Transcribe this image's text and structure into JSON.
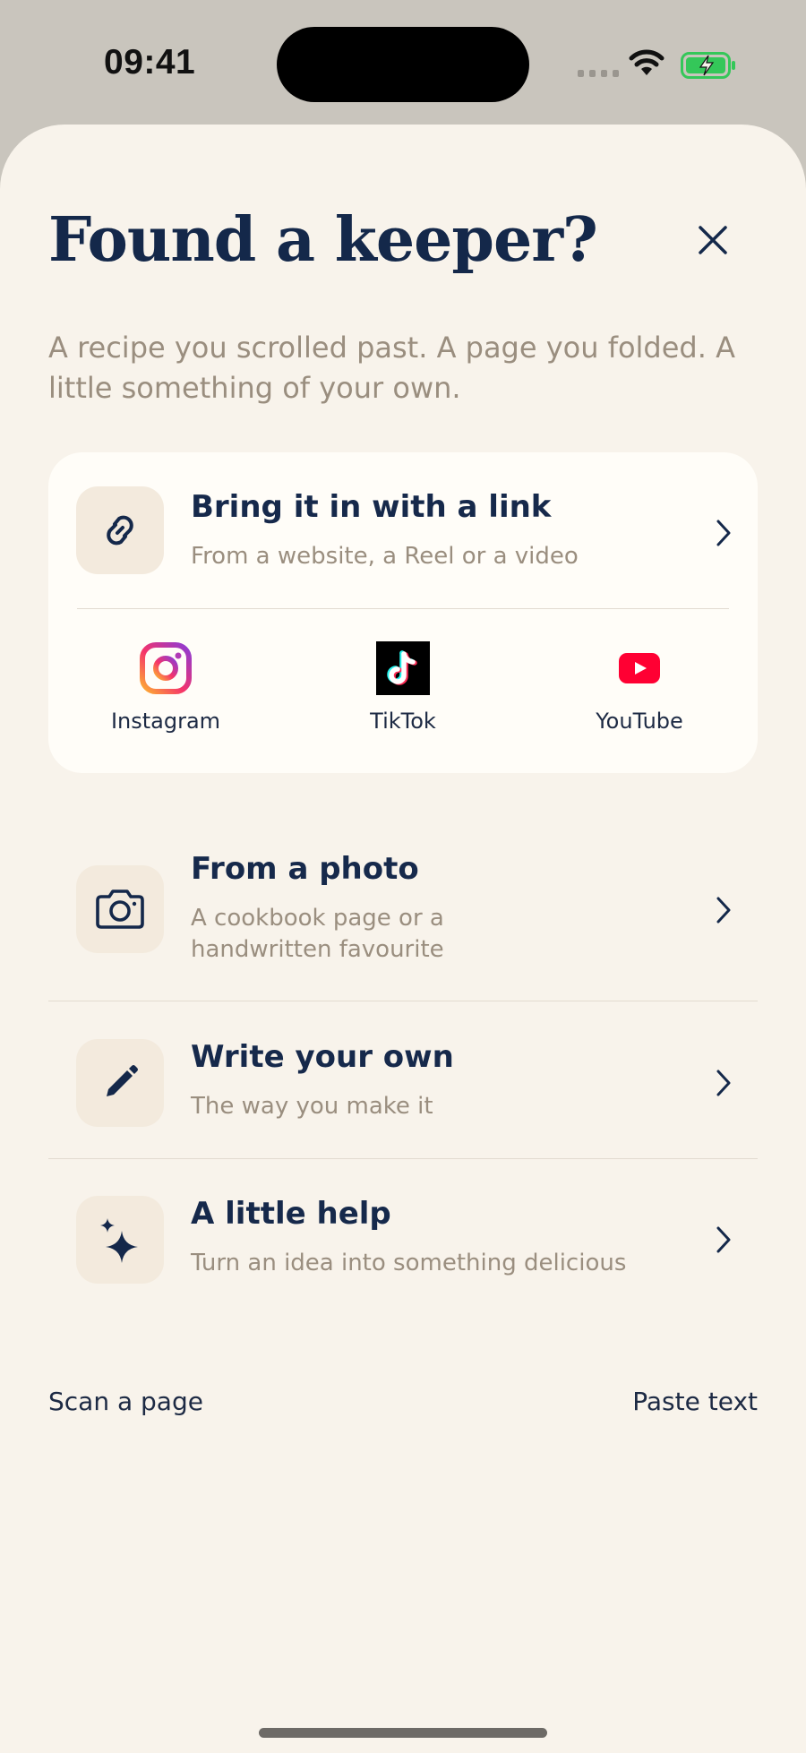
{
  "status": {
    "time": "09:41"
  },
  "sheet": {
    "title": "Found a keeper?",
    "subtitle": "A recipe you scrolled past. A page you folded. A little something of your own."
  },
  "link_option": {
    "title": "Bring it in with a link",
    "subtitle": "From a website, a Reel or a video",
    "icon": "link-icon"
  },
  "sources": [
    {
      "label": "Instagram",
      "icon": "instagram-icon"
    },
    {
      "label": "TikTok",
      "icon": "tiktok-icon"
    },
    {
      "label": "YouTube",
      "icon": "youtube-icon"
    }
  ],
  "options": [
    {
      "title": "From a photo",
      "subtitle": "A cookbook page or a handwritten favourite",
      "icon": "camera-icon"
    },
    {
      "title": "Write your own",
      "subtitle": "The way you make it",
      "icon": "pencil-icon"
    },
    {
      "title": "A little help",
      "subtitle": "Turn an idea into something delicious",
      "icon": "sparkles-icon"
    }
  ],
  "footer": {
    "scan_label": "Scan a page",
    "paste_label": "Paste text"
  },
  "colors": {
    "navy": "#14284a",
    "sheet_bg": "#f8f3eb",
    "card_bg": "#fffdf8",
    "icon_tile": "#f3eadd",
    "muted_text": "#9a8e7f",
    "youtube_red": "#ff0033",
    "battery_green": "#34c759"
  }
}
